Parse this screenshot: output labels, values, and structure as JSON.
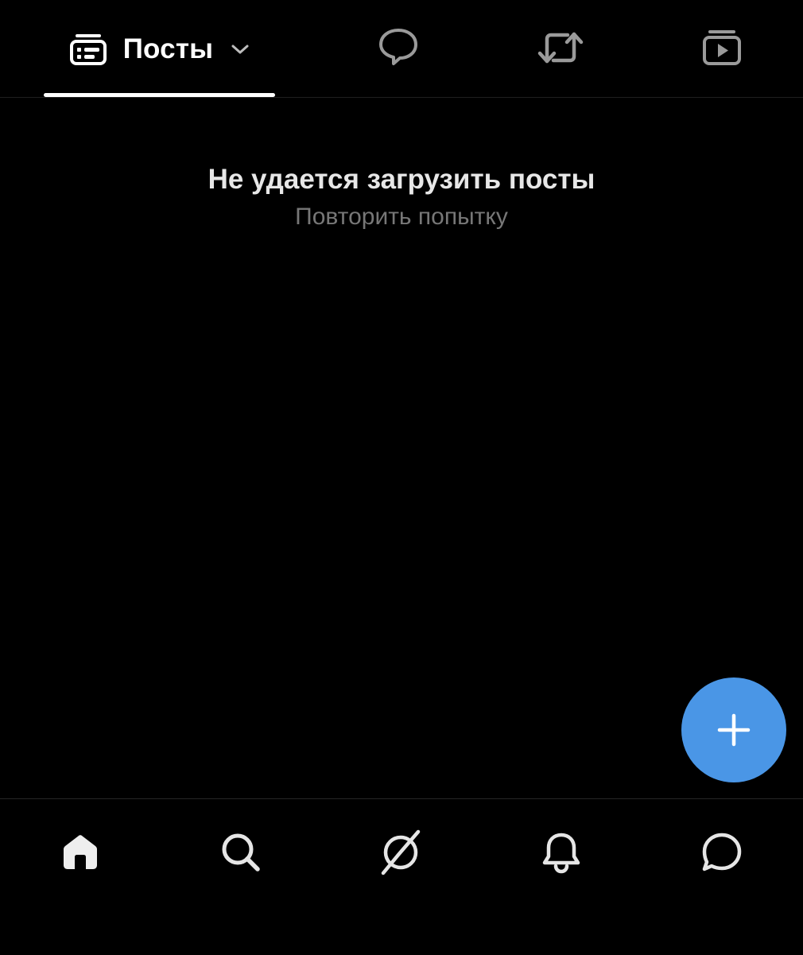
{
  "tabs": {
    "posts": {
      "label": "Посты",
      "icon": "posts-card-icon",
      "dropdown_icon": "chevron-down-icon",
      "active": true
    },
    "replies": {
      "icon": "speech-bubble-icon"
    },
    "reposts": {
      "icon": "repost-icon"
    },
    "videos": {
      "icon": "video-play-icon"
    }
  },
  "main": {
    "error_title": "Не удается загрузить посты",
    "retry_label": "Повторить попытку"
  },
  "fab": {
    "icon": "plus-icon",
    "color": "#4a96e6"
  },
  "bottom_nav": {
    "items": [
      {
        "id": "home",
        "icon": "home-icon",
        "active": true
      },
      {
        "id": "search",
        "icon": "search-icon"
      },
      {
        "id": "feeds",
        "icon": "feeds-icon"
      },
      {
        "id": "notifications",
        "icon": "bell-icon"
      },
      {
        "id": "chat",
        "icon": "chat-bubble-icon"
      }
    ]
  },
  "colors": {
    "background": "#000000",
    "text_primary": "#e7e7e7",
    "text_muted": "#777777",
    "icon_inactive": "#9a9a9a",
    "accent": "#4a96e6"
  }
}
